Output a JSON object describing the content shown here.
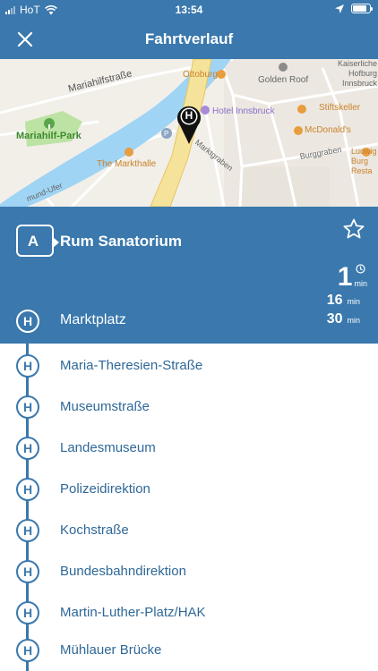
{
  "status_bar": {
    "carrier": "HoT",
    "time": "13:54"
  },
  "nav": {
    "title": "Fahrtverlauf"
  },
  "map": {
    "labels": {
      "mariahilfstrasse": "Mariahilfstraße",
      "mariahilf_park": "Mariahilf-Park",
      "the_markthalle": "The Markthalle",
      "ottoburg": "Ottoburg",
      "golden_roof": "Golden Roof",
      "kaiserliche_hofburg": "Kaiserliche Hofburg Innsbruck",
      "hotel_innsbruck": "Hotel Innsbruck",
      "stiftskeller": "Stiftskeller",
      "mcdonalds": "McDonald's",
      "marktgraben": "Marktgraben",
      "burggraben": "Burggraben",
      "ludwig_burg": "Ludwig Burg Resta",
      "mund_ufer": "mund-Ufer"
    },
    "stop_marker_letter": "H"
  },
  "route": {
    "line": "A",
    "destination": "Rum Sanatorium",
    "departures": [
      {
        "value": "1",
        "unit": "min"
      },
      {
        "value": "16",
        "unit": "min"
      },
      {
        "value": "30",
        "unit": "min"
      }
    ],
    "current_stop": "Marktplatz"
  },
  "stop_icon_letter": "H",
  "stops": [
    "Maria-Theresien-Straße",
    "Museumstraße",
    "Landesmuseum",
    "Polizeidirektion",
    "Kochstraße",
    "Bundesbahndirektion",
    "Martin-Luther-Platz/HAK",
    "Mühlauer Brücke"
  ],
  "colors": {
    "primary": "#3a78ad",
    "stop_text": "#2f6898",
    "river": "#9fd4f4",
    "map_bg": "#f2efe9"
  },
  "icons": {
    "close": "close-icon",
    "favorite": "star-icon",
    "stop": "bus-stop-icon",
    "clock": "clock-icon",
    "location": "location-arrow-icon",
    "wifi": "wifi-icon",
    "battery": "battery-icon"
  }
}
